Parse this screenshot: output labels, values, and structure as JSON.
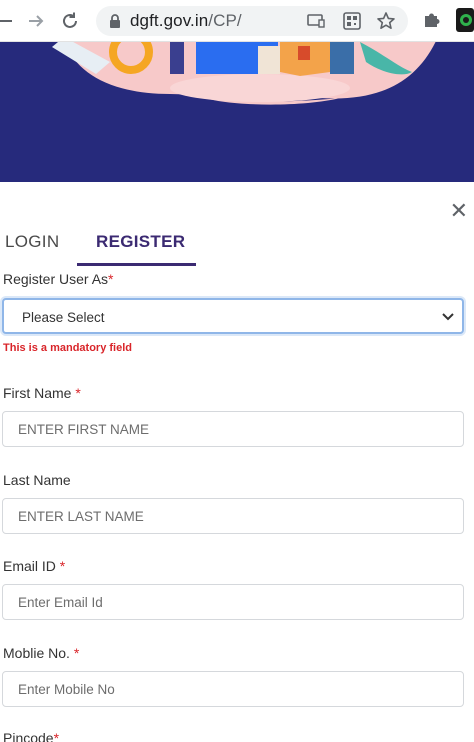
{
  "browser": {
    "url_domain": "dgft.gov.in",
    "url_path": "/CP/"
  },
  "tabs": {
    "login_label": "LOGIN",
    "register_label": "REGISTER"
  },
  "form": {
    "register_user_as": {
      "label": "Register User As",
      "required_mark": "*",
      "selected_value": "Please Select",
      "error": "This is a mandatory field"
    },
    "first_name": {
      "label": "First Name ",
      "required_mark": "*",
      "placeholder": "ENTER FIRST NAME"
    },
    "last_name": {
      "label": "Last Name",
      "placeholder": "ENTER LAST NAME"
    },
    "email": {
      "label": "Email ID ",
      "required_mark": "*",
      "placeholder": "Enter Email Id"
    },
    "mobile": {
      "label": "Moblie No. ",
      "required_mark": "*",
      "placeholder": "Enter Mobile No"
    },
    "pincode": {
      "label": "Pincode",
      "required_mark": "*"
    }
  },
  "colors": {
    "hero_bg": "#262a7c",
    "accent": "#3b2a72",
    "error": "#d9252a"
  }
}
